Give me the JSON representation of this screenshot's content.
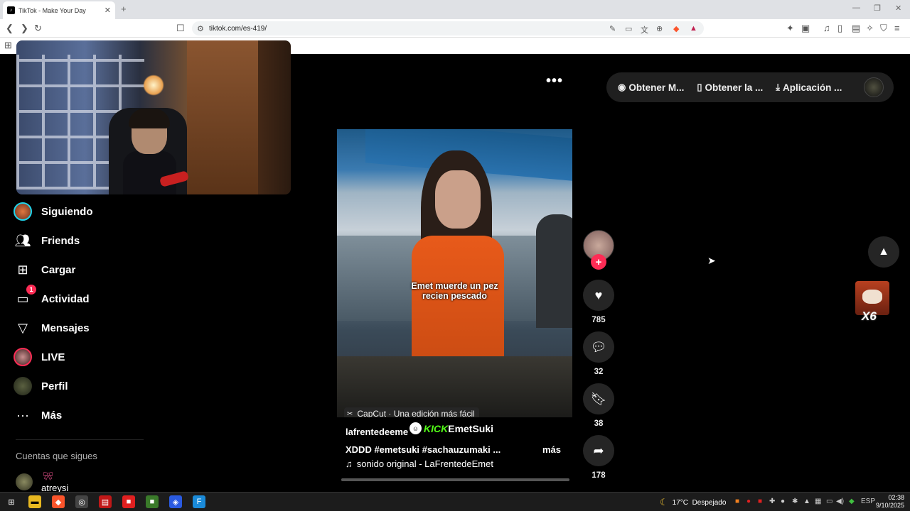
{
  "browser": {
    "tab_title": "TikTok - Make Your Day",
    "url": "tiktok.com/es-419/"
  },
  "sidebar": {
    "items": [
      {
        "label": "Siguiendo",
        "icon": "following-avatar-icon"
      },
      {
        "label": "Friends",
        "icon": "friends-icon"
      },
      {
        "label": "Cargar",
        "icon": "upload-icon"
      },
      {
        "label": "Actividad",
        "icon": "activity-icon",
        "badge": "1"
      },
      {
        "label": "Mensajes",
        "icon": "messages-icon"
      },
      {
        "label": "LIVE",
        "icon": "live-avatar-icon"
      },
      {
        "label": "Perfil",
        "icon": "profile-avatar-icon"
      },
      {
        "label": "Más",
        "icon": "more-icon"
      }
    ],
    "following_title": "Cuentas que sigues",
    "following_accounts": [
      {
        "name": "atreysi"
      }
    ]
  },
  "header": {
    "buttons": [
      {
        "label": "Obtener M...",
        "icon": "coins-icon"
      },
      {
        "label": "Obtener la ...",
        "icon": "phone-icon"
      },
      {
        "label": "Aplicación ...",
        "icon": "download-icon"
      }
    ]
  },
  "video": {
    "caption_line1": "Emet muerde un pez",
    "caption_line2": "recien pescado",
    "capcut_label": "CapCut · Una edición más fácil",
    "author": "lafrentedeeme",
    "overlay_kick": "KICK",
    "overlay_name": "EmetSuki",
    "description": "XDDD #emetsuki  #sachauzumaki  ...",
    "more_label": "más",
    "sound": "sonido original - LaFrentedeEmet",
    "progress": 1.0
  },
  "actions": {
    "likes": "785",
    "comments": "32",
    "saves": "38",
    "shares": "178"
  },
  "overlay": {
    "multiplier": "X6"
  },
  "taskbar": {
    "weather_temp": "17°C",
    "weather_desc": "Despejado",
    "language": "ESP",
    "time": "02:38",
    "date": "9/10/2025"
  }
}
